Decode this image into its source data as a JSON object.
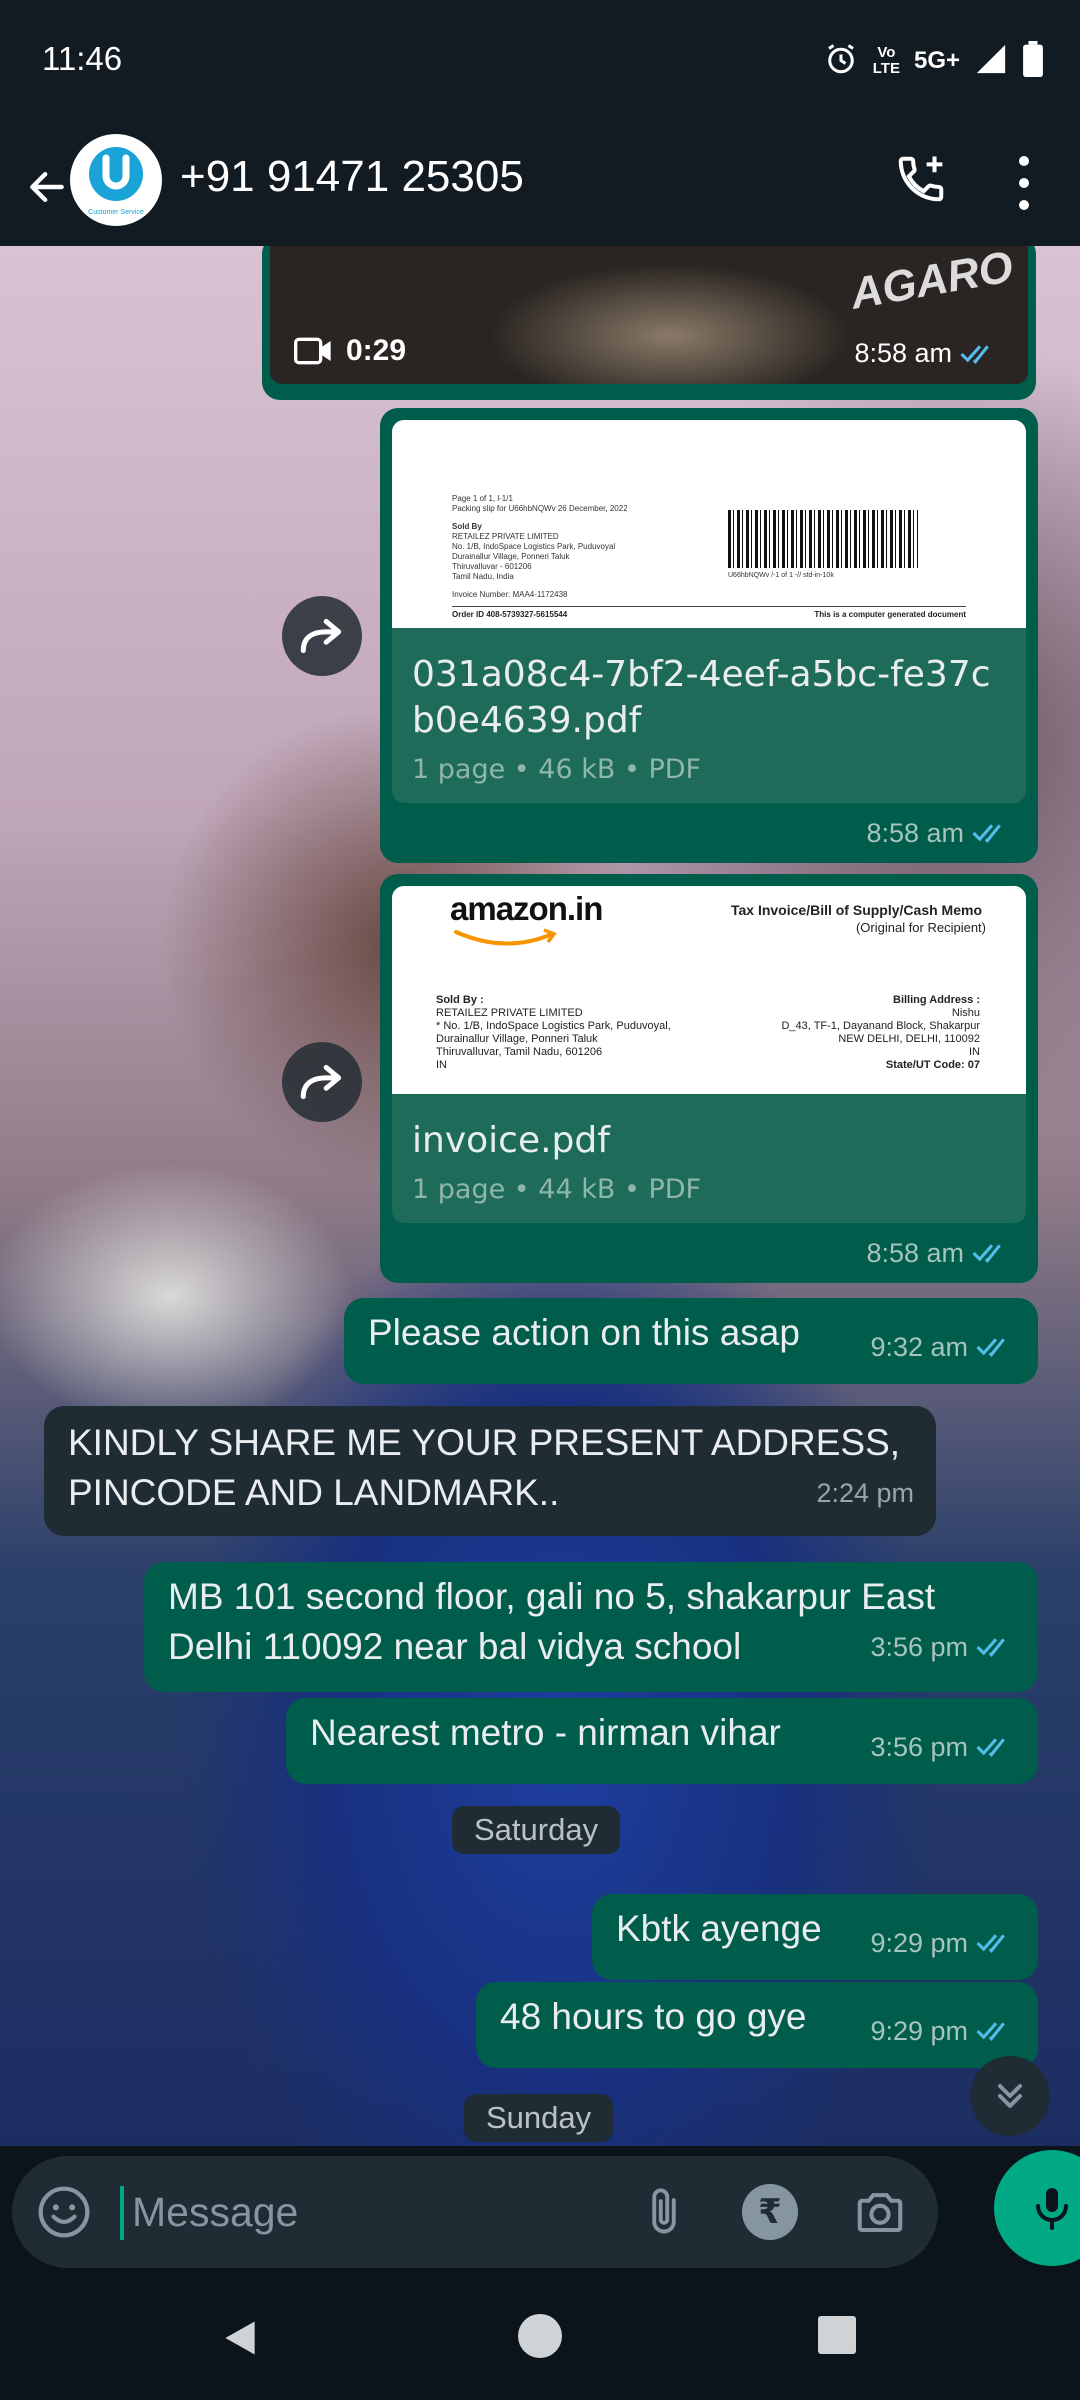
{
  "status_bar": {
    "time": "11:46",
    "network_label_top": "Vo",
    "network_label_bottom": "LTE",
    "network_type": "5G+"
  },
  "header": {
    "contact_name": "+91 91471 25305",
    "avatar_caption": "Customer Service"
  },
  "messages": {
    "video": {
      "brand_text": "AGARO",
      "duration": "0:29",
      "time": "8:58 am"
    },
    "doc1": {
      "file_name": "031a08c4-7bf2-4eef-a5bc-fe37cb0e4639.pdf",
      "meta": "1 page • 46 kB • PDF",
      "time": "8:58 am",
      "preview": {
        "line1": "Page 1 of 1, l-1/1",
        "line2": "Packing slip for U66hbNQWv 26 December, 2022",
        "sold_by_label": "Sold By",
        "seller": "RETAILEZ PRIVATE LIMITED",
        "addr1": "No. 1/B, IndoSpace Logistics Park, Puduvoyal",
        "addr2": "Durainallur Village, Ponneri Taluk",
        "addr3": "Thiruvalluvar - 601206",
        "addr4": "Tamil Nadu, India",
        "invoice_number": "Invoice Number: MAA4-1172438",
        "barcode_caption": "U66hbNQWv /-1 of 1 -// std-in-10k",
        "order_id": "Order ID 408-5739327-5615544",
        "note": "This is a computer generated document"
      }
    },
    "doc2": {
      "file_name": "invoice.pdf",
      "meta": "1 page • 44 kB • PDF",
      "time": "8:58 am",
      "preview": {
        "logo": "amazon.in",
        "title": "Tax Invoice/Bill of Supply/Cash Memo",
        "subtitle": "(Original for Recipient)",
        "sold_by_label": "Sold By :",
        "seller": "RETAILEZ PRIVATE LIMITED",
        "seller_addr1": "* No. 1/B, IndoSpace Logistics Park, Puduvoyal,",
        "seller_addr2": "Durainallur Village, Ponneri Taluk",
        "seller_addr3": "Thiruvalluvar, Tamil Nadu, 601206",
        "seller_addr4": "IN",
        "billing_label": "Billing Address :",
        "bill_name": "Nishu",
        "bill_addr1": "D_43, TF-1, Dayanand Block, Shakarpur",
        "bill_addr2": "NEW DELHI, DELHI, 110092",
        "bill_addr3": "IN",
        "state_code": "State/UT Code: 07"
      }
    },
    "m1": {
      "text": "Please action on this asap",
      "time": "9:32 am"
    },
    "m2": {
      "line1": "KINDLY SHARE ME YOUR PRESENT ADDRESS,",
      "line2": "PINCODE AND LANDMARK..",
      "time": "2:24 pm"
    },
    "m3": {
      "line1": "MB 101 second floor, gali no 5, shakarpur East",
      "line2": "Delhi 110092 near bal vidya school",
      "time": "3:56 pm"
    },
    "m4": {
      "text": "Nearest metro - nirman vihar",
      "time": "3:56 pm"
    },
    "date1": "Saturday",
    "m5": {
      "text": "Kbtk ayenge",
      "time": "9:29 pm"
    },
    "m6": {
      "text": "48 hours to go gye",
      "time": "9:29 pm"
    },
    "date2": "Sunday"
  },
  "composer": {
    "placeholder": "Message",
    "rupee_symbol": "₹"
  },
  "colors": {
    "outgoing_bubble": "#005c4b",
    "incoming_bubble": "#1f2c34",
    "accent": "#00a884",
    "read_tick": "#53bdeb"
  }
}
